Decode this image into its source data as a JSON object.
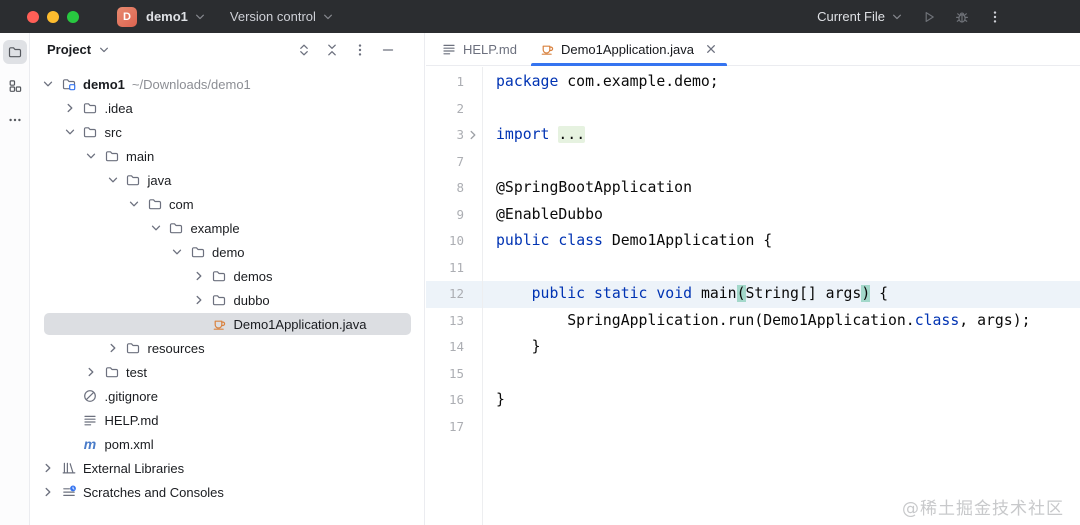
{
  "titlebar": {
    "app_icon_letter": "D",
    "project_selector": "demo1",
    "vcs_selector": "Version control",
    "run_config": "Current File",
    "right_icons": [
      "run",
      "debug",
      "more"
    ]
  },
  "tool_strip": {
    "items": [
      {
        "icon": "project-folder",
        "selected": true
      },
      {
        "icon": "structure",
        "selected": false
      },
      {
        "icon": "more-horizontal",
        "selected": false
      }
    ]
  },
  "project_panel": {
    "title": "Project",
    "header_icons": [
      "expand-all",
      "collapse-all",
      "options",
      "hide"
    ],
    "tree": [
      {
        "level": 0,
        "chevron": "down",
        "icon": "project-folder-badge",
        "label": "demo1",
        "bold": true,
        "extra": "~/Downloads/demo1"
      },
      {
        "level": 1,
        "chevron": "right",
        "icon": "folder",
        "label": ".idea"
      },
      {
        "level": 1,
        "chevron": "down",
        "icon": "folder",
        "label": "src"
      },
      {
        "level": 2,
        "chevron": "down",
        "icon": "folder",
        "label": "main"
      },
      {
        "level": 3,
        "chevron": "down",
        "icon": "folder",
        "label": "java"
      },
      {
        "level": 4,
        "chevron": "down",
        "icon": "folder",
        "label": "com"
      },
      {
        "level": 5,
        "chevron": "down",
        "icon": "folder",
        "label": "example"
      },
      {
        "level": 6,
        "chevron": "down",
        "icon": "folder",
        "label": "demo"
      },
      {
        "level": 7,
        "chevron": "right",
        "icon": "folder",
        "label": "demos"
      },
      {
        "level": 7,
        "chevron": "right",
        "icon": "folder",
        "label": "dubbo"
      },
      {
        "level": 7,
        "chevron": "none",
        "icon": "java-class",
        "label": "Demo1Application.java",
        "selected": true
      },
      {
        "level": 3,
        "chevron": "right",
        "icon": "folder",
        "label": "resources"
      },
      {
        "level": 2,
        "chevron": "right",
        "icon": "folder",
        "label": "test"
      },
      {
        "level": 1,
        "chevron": "none",
        "icon": "gitignore",
        "label": ".gitignore"
      },
      {
        "level": 1,
        "chevron": "none",
        "icon": "markdown",
        "label": "HELP.md"
      },
      {
        "level": 1,
        "chevron": "none",
        "icon": "maven",
        "label": "pom.xml"
      },
      {
        "level": 0,
        "chevron": "right",
        "icon": "library",
        "label": "External Libraries"
      },
      {
        "level": 0,
        "chevron": "right",
        "icon": "scratches",
        "label": "Scratches and Consoles"
      }
    ]
  },
  "editor": {
    "tabs": [
      {
        "label": "HELP.md",
        "icon": "markdown",
        "active": false,
        "closable": false
      },
      {
        "label": "Demo1Application.java",
        "icon": "java-class",
        "active": true,
        "closable": true
      }
    ],
    "code": {
      "current_line": "12",
      "lines": [
        {
          "n": "1",
          "segs": [
            {
              "t": "package",
              "c": "kw"
            },
            {
              "t": " com.example.demo;"
            }
          ]
        },
        {
          "n": "2",
          "segs": []
        },
        {
          "n": "3",
          "fold": true,
          "segs": [
            {
              "t": "import",
              "c": "kw"
            },
            {
              "t": " "
            },
            {
              "t": "...",
              "c": "fold"
            }
          ]
        },
        {
          "n": "7",
          "segs": []
        },
        {
          "n": "8",
          "segs": [
            {
              "t": "@SpringBootApplication"
            }
          ]
        },
        {
          "n": "9",
          "segs": [
            {
              "t": "@EnableDubbo"
            }
          ]
        },
        {
          "n": "10",
          "segs": [
            {
              "t": "public",
              "c": "kw"
            },
            {
              "t": " "
            },
            {
              "t": "class",
              "c": "kw"
            },
            {
              "t": " Demo1Application {"
            }
          ]
        },
        {
          "n": "11",
          "segs": []
        },
        {
          "n": "12",
          "current": true,
          "segs": [
            {
              "t": "    "
            },
            {
              "t": "public",
              "c": "kw"
            },
            {
              "t": " "
            },
            {
              "t": "static",
              "c": "kw"
            },
            {
              "t": " "
            },
            {
              "t": "void",
              "c": "kw"
            },
            {
              "t": " main"
            },
            {
              "t": "(",
              "c": "br"
            },
            {
              "t": "String[] args",
              "c": ""
            },
            {
              "t": ")",
              "c": "br"
            },
            {
              "t": " {"
            }
          ]
        },
        {
          "n": "13",
          "segs": [
            {
              "t": "        SpringApplication.run(Demo1Application."
            },
            {
              "t": "class",
              "c": "kw"
            },
            {
              "t": ", args);"
            }
          ]
        },
        {
          "n": "14",
          "segs": [
            {
              "t": "    }"
            }
          ]
        },
        {
          "n": "15",
          "segs": []
        },
        {
          "n": "16",
          "segs": [
            {
              "t": "}"
            }
          ]
        },
        {
          "n": "17",
          "segs": []
        }
      ]
    }
  },
  "watermark": "@稀土掘金技术社区",
  "colors": {
    "titlebar_bg": "#2B2D30",
    "accent_blue": "#3574F0",
    "keyword_blue": "#0033B3",
    "caret_row": "#EDF3F9",
    "fold_bg": "#E6F2E0",
    "brace_match": "#A3D8CA",
    "selection_gray": "#DCDEE2",
    "java_orange": "#D9823F",
    "traffic_red": "#FF5F57",
    "traffic_yellow": "#FEBC2E",
    "traffic_green": "#28C840"
  }
}
